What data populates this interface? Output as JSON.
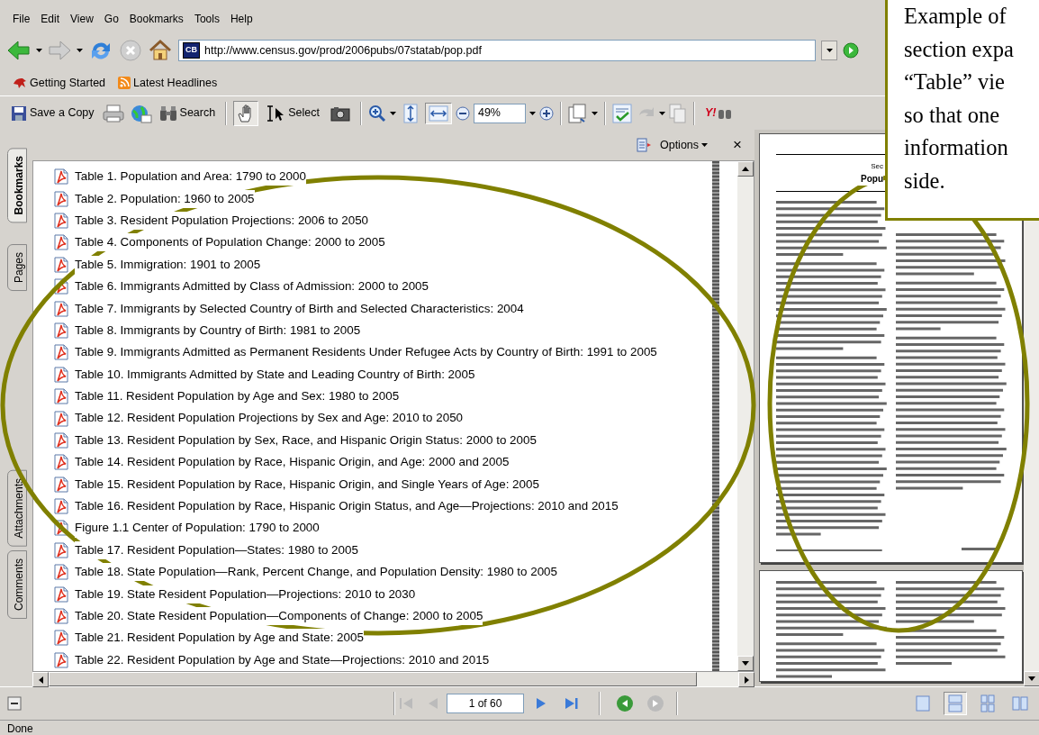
{
  "menu": [
    {
      "label": "File"
    },
    {
      "label": "Edit"
    },
    {
      "label": "View"
    },
    {
      "label": "Go"
    },
    {
      "label": "Bookmarks"
    },
    {
      "label": "Tools"
    },
    {
      "label": "Help"
    }
  ],
  "nav_toolbar": {
    "favicon_text": "CB",
    "address": "http://www.census.gov/prod/2006pubs/07statab/pop.pdf"
  },
  "bookmarks_toolbar": [
    {
      "label": "Getting Started"
    },
    {
      "label": "Latest Headlines"
    }
  ],
  "reader_toolbar": {
    "save": "Save a Copy",
    "search": "Search",
    "select_tools": [
      {
        "kind": "hand",
        "selected": true
      },
      {
        "kind": "select",
        "label": "Select",
        "selected": false
      },
      {
        "kind": "snapshot",
        "selected": false
      }
    ],
    "fit_buttons": [
      {
        "kind": "fit-page",
        "selected": false
      },
      {
        "kind": "fit-width",
        "selected": true
      }
    ],
    "zoom": "49%",
    "logo_text": "Y!"
  },
  "side_tabs": [
    {
      "label": "Bookmarks",
      "selected": true
    },
    {
      "label": "Pages",
      "selected": false
    },
    {
      "label": "Attachments",
      "selected": false
    },
    {
      "label": "Comments",
      "selected": false
    }
  ],
  "bookmarks_panel": {
    "options": "Options",
    "close": "×",
    "items": [
      {
        "label": "Table 1. Population and Area: 1790 to 2000"
      },
      {
        "label": "Table 2. Population: 1960 to 2005"
      },
      {
        "label": "Table 3. Resident Population Projections: 2006 to 2050"
      },
      {
        "label": "Table 4. Components of Population Change: 2000 to 2005"
      },
      {
        "label": "Table 5. Immigration: 1901 to 2005"
      },
      {
        "label": "Table 6. Immigrants Admitted by Class of Admission: 2000 to 2005"
      },
      {
        "label": "Table 7. Immigrants by Selected Country of Birth and Selected Characteristics: 2004"
      },
      {
        "label": "Table 8. Immigrants by Country of Birth: 1981 to 2005"
      },
      {
        "label": "Table 9. Immigrants Admitted as Permanent Residents Under Refugee Acts by Country of Birth: 1991 to 2005"
      },
      {
        "label": "Table 10. Immigrants Admitted by State and Leading Country of Birth: 2005"
      },
      {
        "label": "Table 11. Resident Population by Age and Sex: 1980 to 2005"
      },
      {
        "label": "Table 12. Resident Population Projections by Sex and Age: 2010 to 2050"
      },
      {
        "label": "Table 13. Resident Population by Sex, Race, and Hispanic Origin Status: 2000 to 2005"
      },
      {
        "label": "Table 14. Resident Population by Race, Hispanic Origin, and Age: 2000 and 2005"
      },
      {
        "label": "Table 15. Resident Population by Race, Hispanic Origin, and Single Years of Age: 2005"
      },
      {
        "label": "Table 16. Resident Population by Race, Hispanic Origin Status, and Age—Projections: 2010 and 2015"
      },
      {
        "label": "Figure 1.1 Center of Population: 1790 to 2000"
      },
      {
        "label": "Table 17. Resident Population—States: 1980 to 2005"
      },
      {
        "label": "Table 18. State Population—Rank, Percent Change, and Population Density: 1980 to 2005"
      },
      {
        "label": "Table 19. State Resident Population—Projections: 2010 to 2030"
      },
      {
        "label": "Table 20. State Resident Population—Components of Change: 2000 to 2005"
      },
      {
        "label": "Table 21. Resident Population by Age and State: 2005"
      },
      {
        "label": "Table 22. Resident Population by Age and State—Projections: 2010 and 2015"
      }
    ]
  },
  "document": {
    "heading": [
      "Sec",
      "Popu"
    ]
  },
  "page_nav": {
    "page": "1 of 60",
    "layouts": [
      {
        "selected": false
      },
      {
        "selected": true
      },
      {
        "selected": false
      },
      {
        "selected": false
      }
    ]
  },
  "status_bar": "Done",
  "callout": {
    "lines": [
      "Example of",
      "section expa",
      "“Table” vie",
      "so that one",
      "information",
      "side."
    ]
  }
}
